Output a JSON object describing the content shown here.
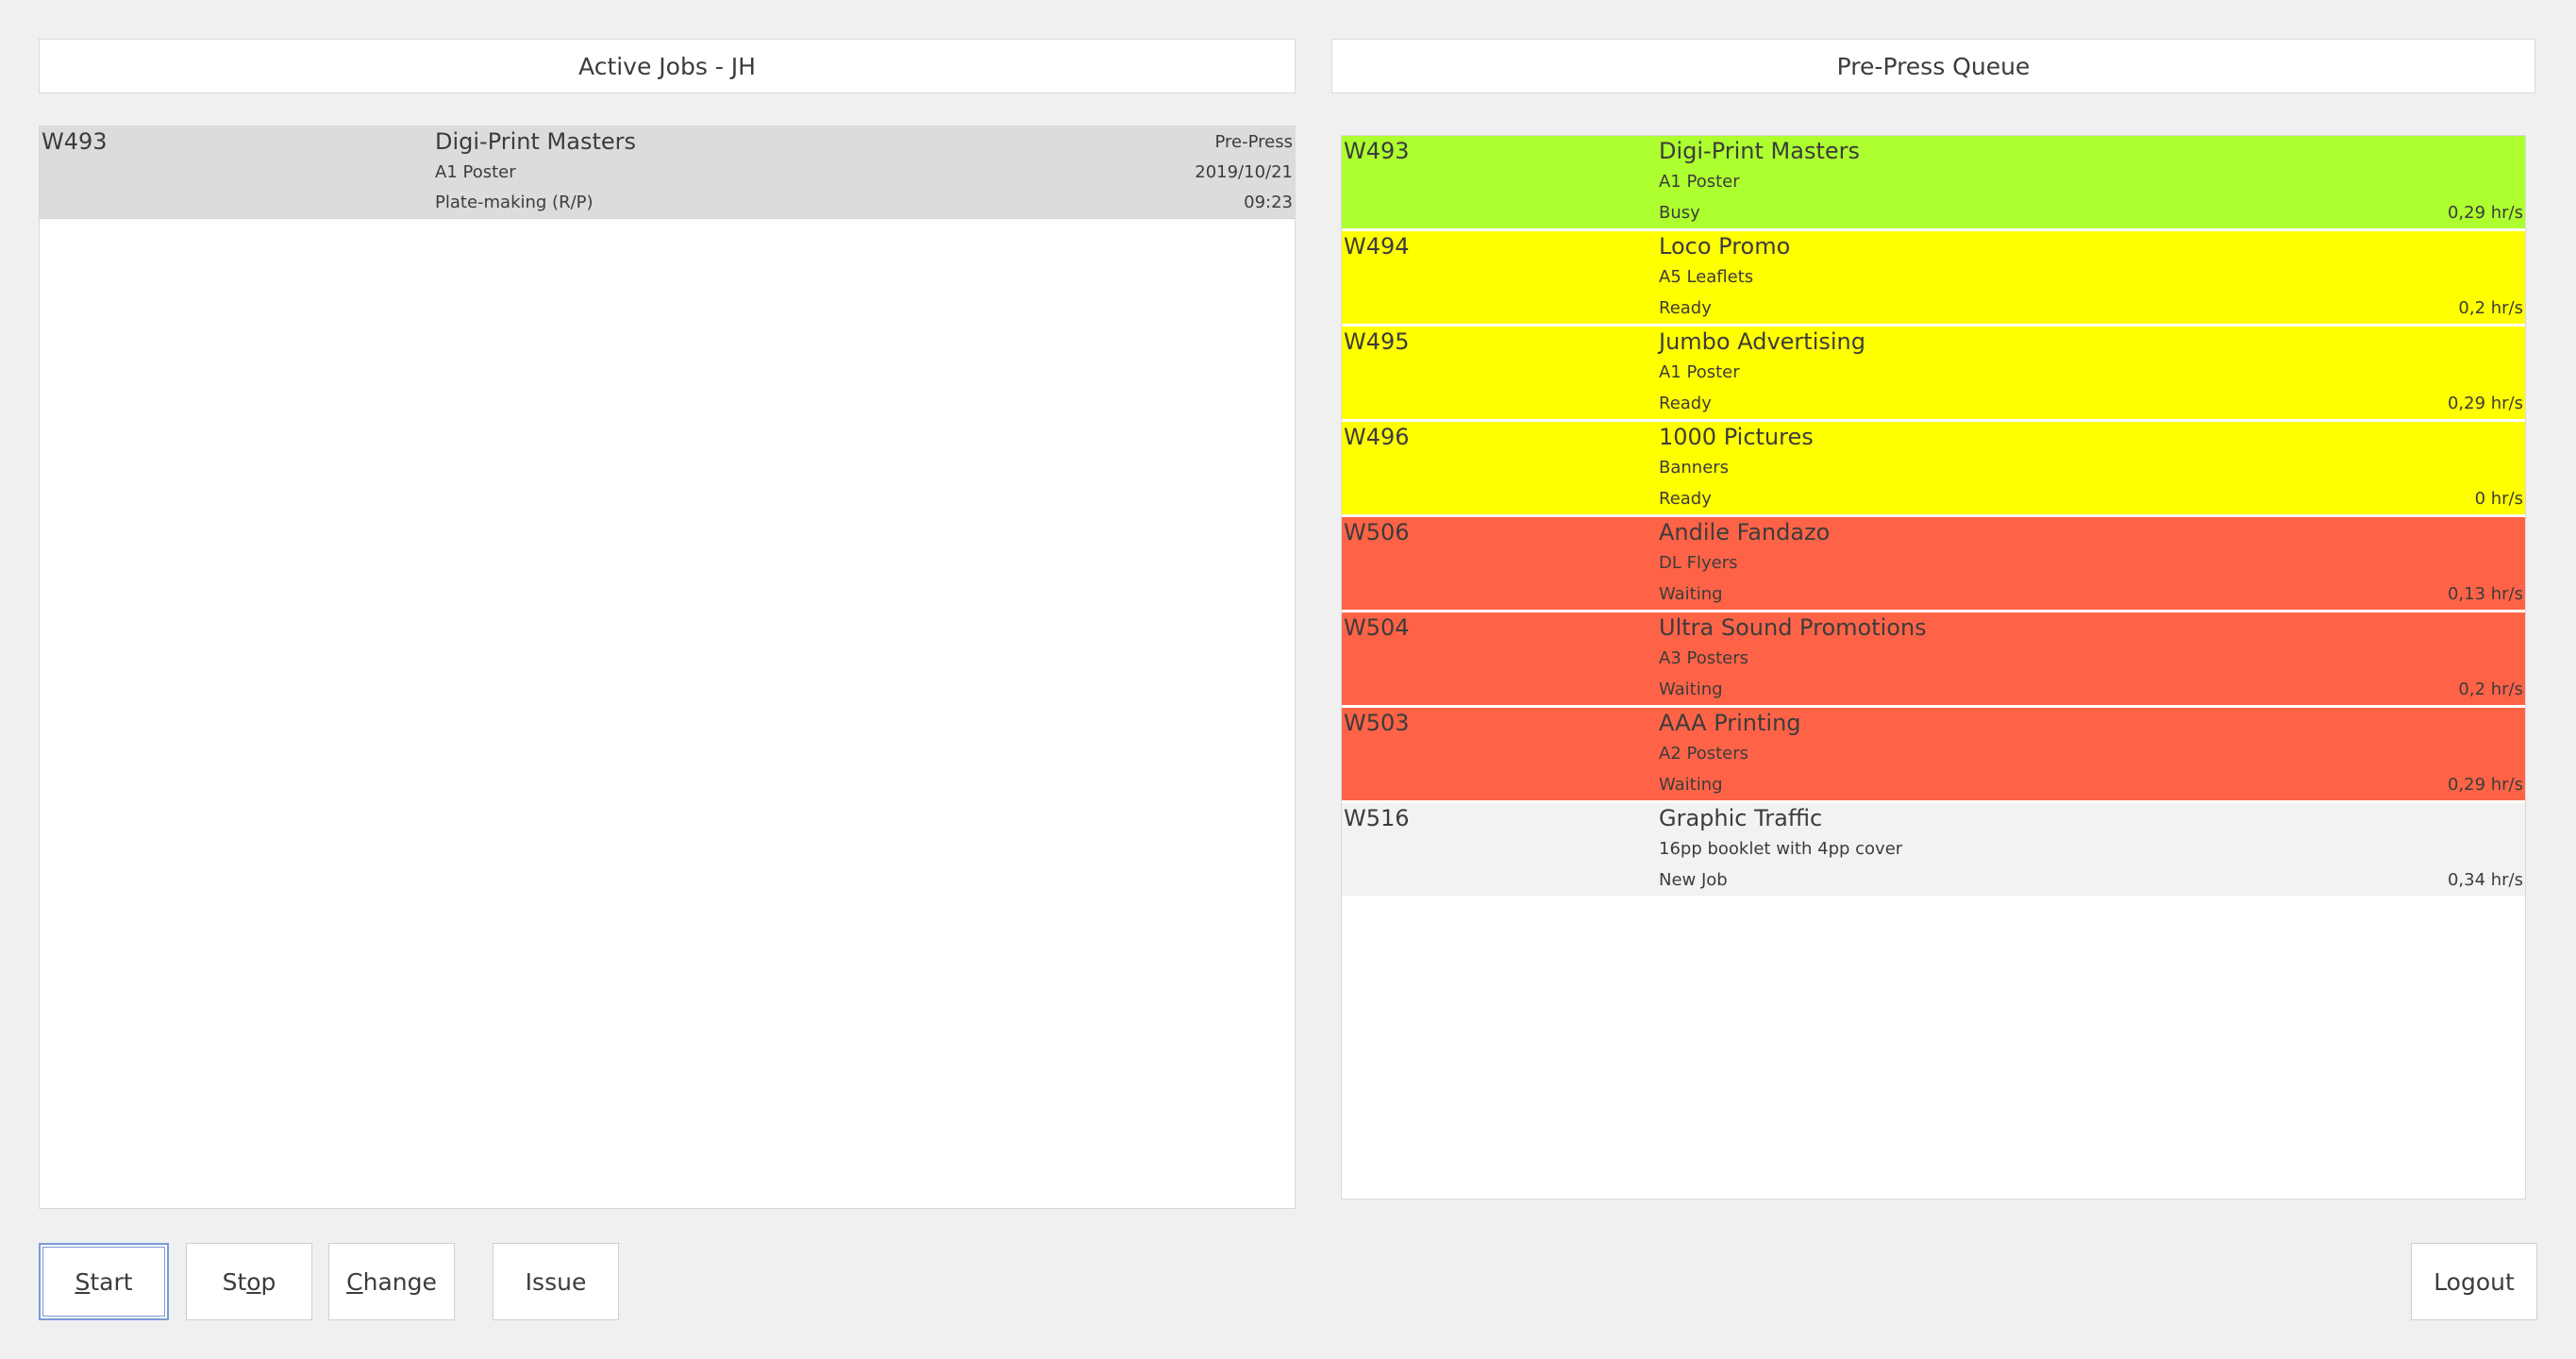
{
  "active_jobs": {
    "title": "Active Jobs - JH",
    "rows": [
      {
        "code": "W493",
        "customer": "Digi-Print Masters",
        "product": "A1 Poster",
        "task": "Plate-making (R/P)",
        "stage": "Pre-Press",
        "date": "2019/10/21",
        "time": "09:23"
      }
    ]
  },
  "queue": {
    "title": "Pre-Press Queue",
    "rows": [
      {
        "code": "W493",
        "customer": "Digi-Print Masters",
        "product": "A1 Poster",
        "status": "Busy",
        "rate": "0,29 hr/s",
        "color": "#adff2f"
      },
      {
        "code": "W494",
        "customer": "Loco Promo",
        "product": "A5 Leaflets",
        "status": "Ready",
        "rate": "0,2 hr/s",
        "color": "#ffff00"
      },
      {
        "code": "W495",
        "customer": "Jumbo Advertising",
        "product": "A1 Poster",
        "status": "Ready",
        "rate": "0,29 hr/s",
        "color": "#ffff00"
      },
      {
        "code": "W496",
        "customer": "1000 Pictures",
        "product": "Banners",
        "status": "Ready",
        "rate": "0 hr/s",
        "color": "#ffff00"
      },
      {
        "code": "W506",
        "customer": "Andile Fandazo",
        "product": "DL Flyers",
        "status": "Waiting",
        "rate": "0,13 hr/s",
        "color": "#ff6347"
      },
      {
        "code": "W504",
        "customer": "Ultra Sound Promotions",
        "product": "A3 Posters",
        "status": "Waiting",
        "rate": "0,2 hr/s",
        "color": "#ff6347"
      },
      {
        "code": "W503",
        "customer": "AAA Printing",
        "product": "A2 Posters",
        "status": "Waiting",
        "rate": "0,29 hr/s",
        "color": "#ff6347"
      },
      {
        "code": "W516",
        "customer": "Graphic Traffic",
        "product": "16pp booklet with 4pp cover",
        "status": "New Job",
        "rate": "0,34 hr/s",
        "color": "#f2f2f2"
      }
    ]
  },
  "buttons": {
    "start": {
      "first": "S",
      "rest": "tart"
    },
    "stop": {
      "first": "St",
      "u": "o",
      "rest": "p"
    },
    "change": {
      "u": "C",
      "rest": "hange"
    },
    "issue": "Issue",
    "logout": "Logout"
  }
}
